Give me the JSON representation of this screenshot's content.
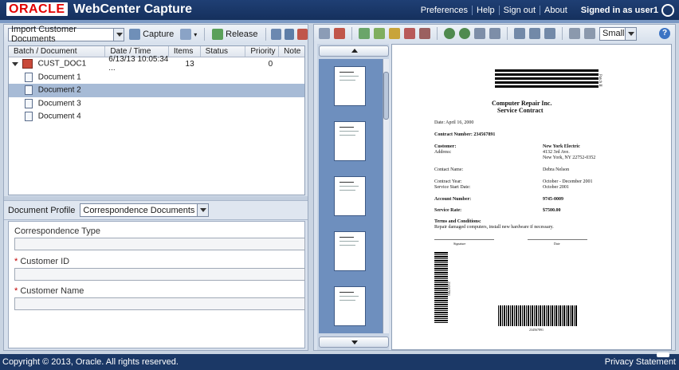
{
  "header": {
    "logo": "ORACLE",
    "app_title": "WebCenter Capture",
    "nav": [
      "Preferences",
      "Help",
      "Sign out",
      "About"
    ],
    "signed_in": "Signed in as user1"
  },
  "left": {
    "toolbar": {
      "client_select": "Import Customer Documents",
      "capture_label": "Capture",
      "release_label": "Release"
    },
    "table": {
      "columns": [
        "Batch / Document",
        "Date / Time",
        "Items",
        "Status",
        "Priority",
        "Note"
      ],
      "batch": {
        "name": "CUST_DOC1",
        "datetime": "6/13/13 10:05:34 ...",
        "items": "13",
        "status": "",
        "priority": "0",
        "note": ""
      },
      "documents": [
        "Document 1",
        "Document 2",
        "Document 3",
        "Document 4"
      ],
      "selected_document": "Document 2"
    },
    "profile": {
      "label": "Document Profile",
      "value": "Correspondence Documents"
    },
    "form": {
      "fields": [
        {
          "label": "Correspondence Type",
          "required": "",
          "value": ""
        },
        {
          "label": "Customer ID",
          "required": "*",
          "value": ""
        },
        {
          "label": "Customer Name",
          "required": "*",
          "value": ""
        }
      ]
    }
  },
  "right": {
    "zoom_select": "Small",
    "help": "?",
    "document": {
      "patch": "Patch II",
      "company": "Computer Repair Inc.",
      "doc_type": "Service Contract",
      "date_line": "Date: April 16, 2000",
      "contract_number": "Contract Number: 234567891",
      "customer_label": "Customer:",
      "address_label": "Address:",
      "customer_name": "New York Electric",
      "addr1": "4132 3rd Ave.",
      "addr2": "New York, NY 22752-0352",
      "contact_label": "Contact Name:",
      "contact_value": "Debra Nelson",
      "contract_year_label": "Contract Year:",
      "contract_year_value": "October - December 2001",
      "start_label": "Service Start Date:",
      "start_value": "October 2001",
      "account_label": "Account Number:",
      "account_value": "9745-0009",
      "rate_label": "Service Rate:",
      "rate_value": "$7500.00",
      "terms_label": "Terms and Conditions:",
      "terms_text": "Repair damaged computers, install new hardware if necessary.",
      "signature_label": "Signature",
      "date_label": "Date",
      "barcode_number": "234567891",
      "vertical_code": "234567891"
    }
  },
  "footer": {
    "copyright": "Copyright © 2013, Oracle. All rights reserved.",
    "privacy": "Privacy Statement"
  },
  "colors": {
    "header_bg": "#1f3f74",
    "selected_row": "#a7bbd6",
    "thumb_strip": "#6e8fbe"
  }
}
